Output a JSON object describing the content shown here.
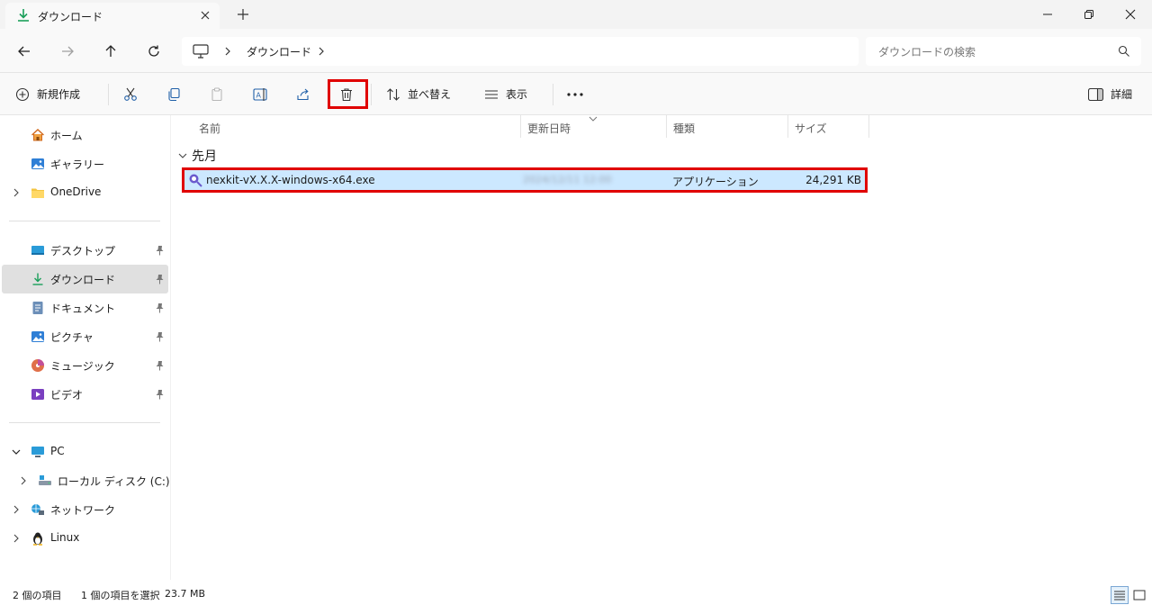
{
  "tab": {
    "title": "ダウンロード"
  },
  "address": {
    "path_segment": "ダウンロード",
    "search_placeholder": "ダウンロードの検索"
  },
  "commands": {
    "new": "新規作成",
    "sort": "並べ替え",
    "view": "表示",
    "details": "詳細"
  },
  "sidebar": {
    "home": "ホーム",
    "gallery": "ギャラリー",
    "onedrive": "OneDrive",
    "desktop": "デスクトップ",
    "downloads": "ダウンロード",
    "documents": "ドキュメント",
    "pictures": "ピクチャ",
    "music": "ミュージック",
    "videos": "ビデオ",
    "pc": "PC",
    "local_disk": "ローカル ディスク (C:)",
    "network": "ネットワーク",
    "linux": "Linux"
  },
  "columns": {
    "name": "名前",
    "modified": "更新日時",
    "type": "種類",
    "size": "サイズ"
  },
  "group": {
    "label": "先月"
  },
  "files": [
    {
      "name": "nexkit-vX.X.X-windows-x64.exe",
      "modified": "2024/12/11 12:00",
      "type": "アプリケーション",
      "size": "24,291 KB"
    }
  ],
  "status": {
    "count": "2 個の項目",
    "selected": "1 個の項目を選択",
    "selected_size": "23.7 MB"
  },
  "colors": {
    "accent": "#0067c0",
    "selection": "#cce8ff",
    "highlight_box": "#e00000"
  }
}
